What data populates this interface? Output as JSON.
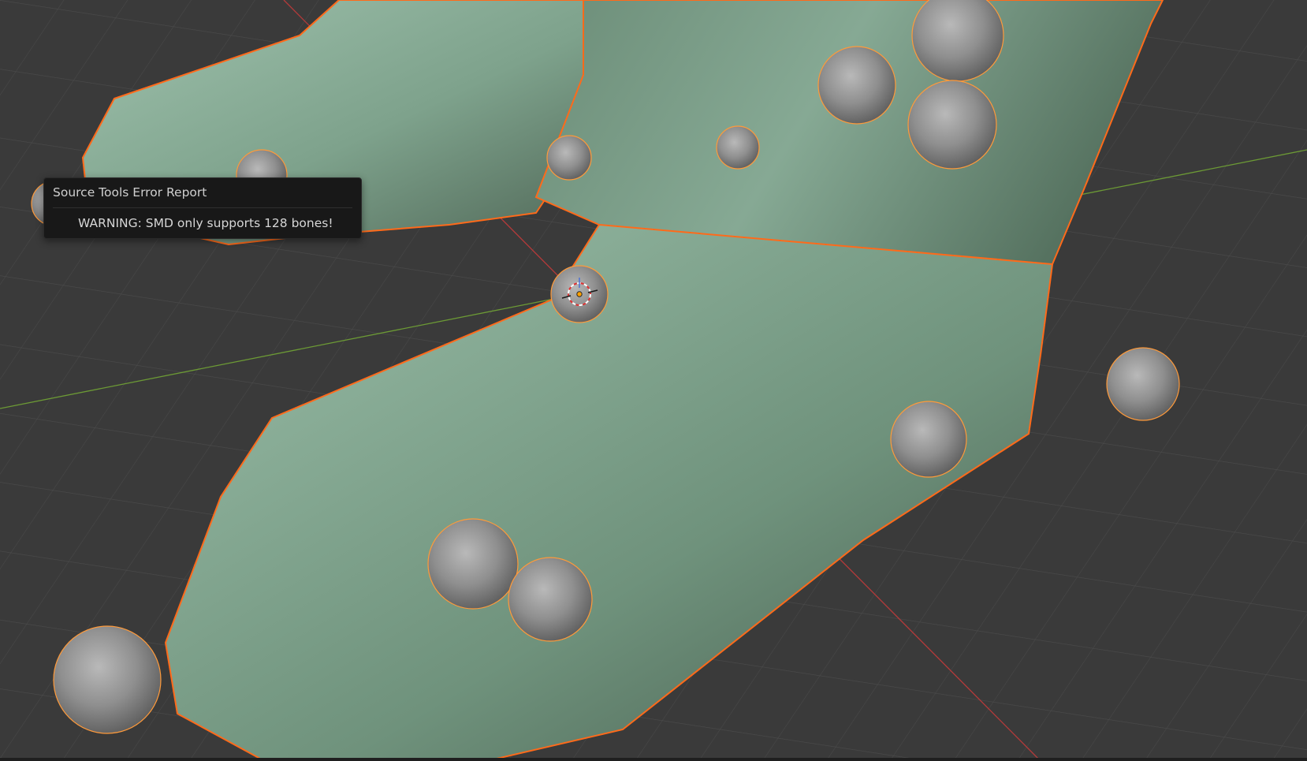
{
  "error_report": {
    "title": "Source Tools Error Report",
    "message": "WARNING: SMD only supports 128 bones!"
  },
  "viewport": {
    "background_color": "#3a3a3a",
    "grid_color": "#4a4a4a",
    "x_axis_color": "#b53a3a",
    "y_axis_color": "#6c9a35",
    "mesh_color": "#86a994",
    "selection_outline_color": "#ff7a1a",
    "sphere_color": "#8e8e8e",
    "icons": [
      "object-origin-icon",
      "3d-cursor-icon"
    ]
  }
}
